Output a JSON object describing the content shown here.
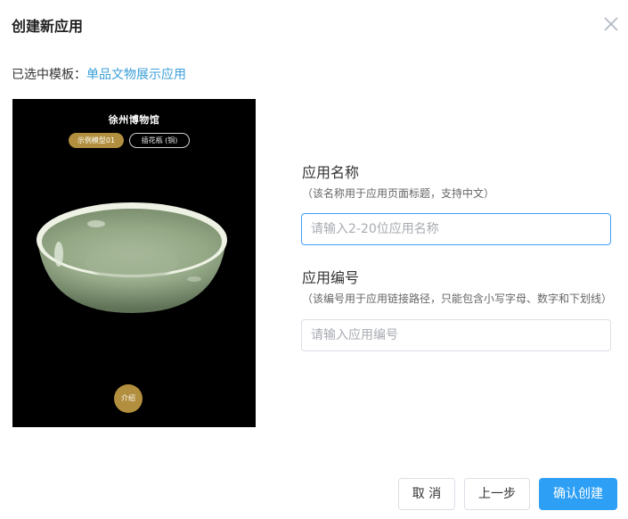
{
  "dialog": {
    "title": "创建新应用",
    "close_icon": "close-icon"
  },
  "template": {
    "prefix": "已选中模板：",
    "name": "单品文物展示应用"
  },
  "preview": {
    "museum_name": "徐州博物馆",
    "pill_selected": "示例模型01",
    "pill_other": "插花瓶 (铜)",
    "intro_button": "介绍",
    "colors": {
      "background": "#000000",
      "accent": "#b28f3e",
      "bowl": "#9aae8f"
    }
  },
  "form": {
    "app_name": {
      "label": "应用名称",
      "hint": "（该名称用于应用页面标题，支持中文）",
      "placeholder": "请输入2-20位应用名称",
      "value": ""
    },
    "app_code": {
      "label": "应用编号",
      "hint": "（该编号用于应用链接路径，只能包含小写字母、数字和下划线）",
      "placeholder": "请输入应用编号",
      "value": ""
    }
  },
  "footer": {
    "cancel": "取 消",
    "prev": "上一步",
    "confirm": "确认创建"
  },
  "colors": {
    "primary": "#2d9ff5",
    "link": "#3a9fd8",
    "focus_border": "#409eff"
  }
}
